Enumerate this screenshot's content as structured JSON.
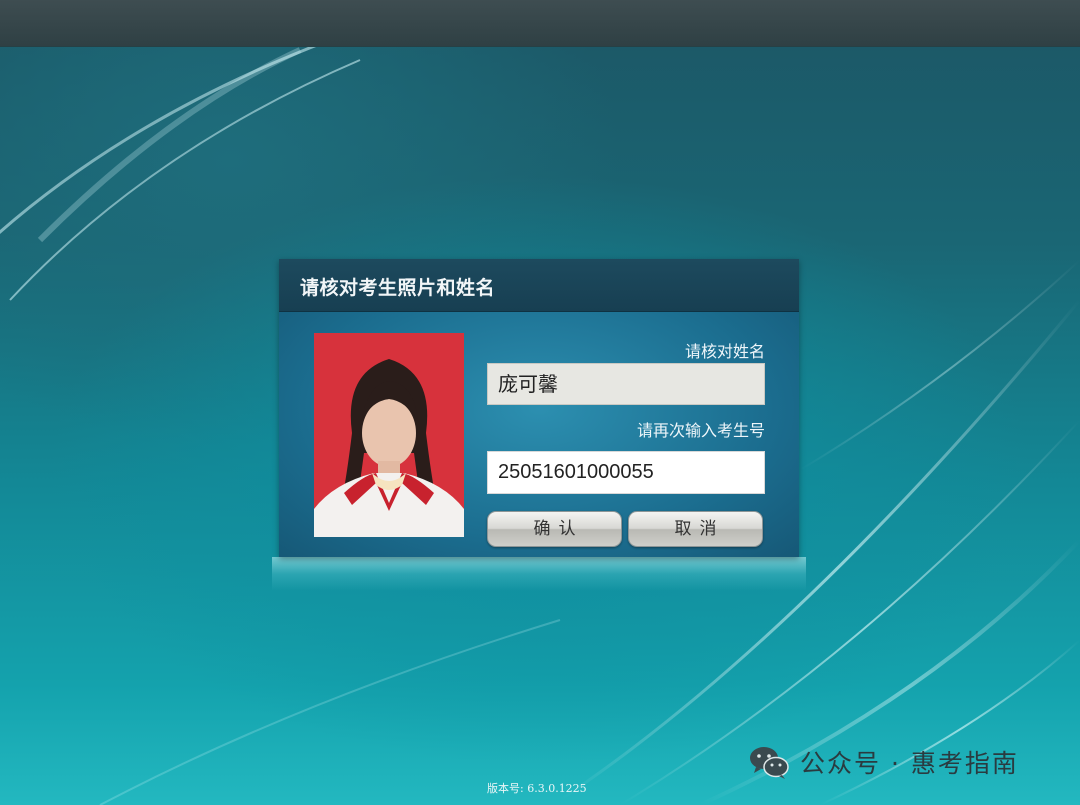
{
  "dialog": {
    "title": "请核对考生照片和姓名",
    "name_label": "请核对姓名",
    "name_value": "庞可馨",
    "id_label": "请再次输入考生号",
    "id_value": "25051601000055",
    "confirm_label": "确认",
    "cancel_label": "取消"
  },
  "footer": {
    "version": "版本号: 6.3.0.1225"
  },
  "watermark": {
    "text": "公众号 · 惠考指南",
    "icon": "wechat-icon"
  },
  "colors": {
    "photo_background": "#d7323c",
    "dialog_header": "#1d4a5e",
    "desktop_accent": "#14a2ad"
  }
}
